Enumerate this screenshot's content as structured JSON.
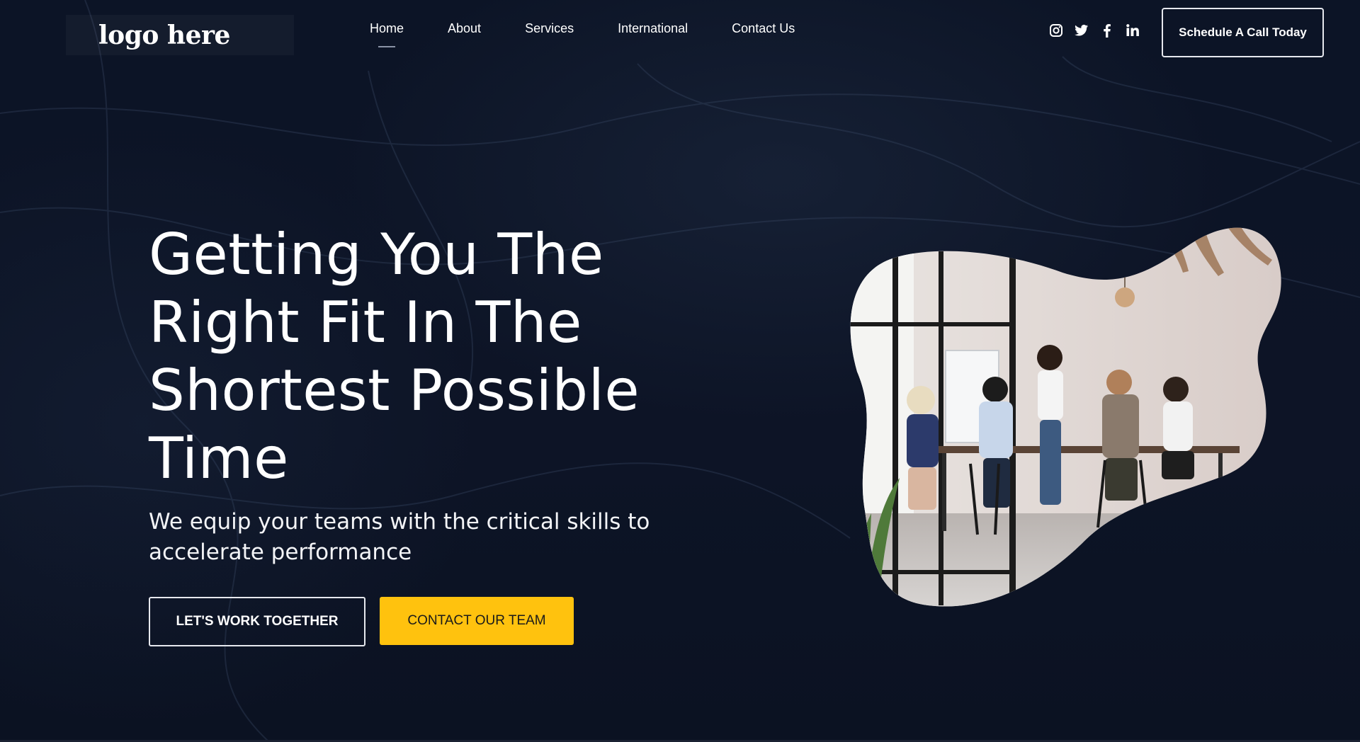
{
  "header": {
    "logo_text": "logo here",
    "nav": [
      {
        "label": "Home",
        "active": true
      },
      {
        "label": "About",
        "active": false
      },
      {
        "label": "Services",
        "active": false
      },
      {
        "label": "International",
        "active": false
      },
      {
        "label": "Contact Us",
        "active": false
      }
    ],
    "socials": [
      "instagram-icon",
      "twitter-icon",
      "facebook-icon",
      "linkedin-icon"
    ],
    "cta_label": "Schedule A Call Today"
  },
  "hero": {
    "title_lines": [
      "Getting You The",
      "Right Fit In The",
      "Shortest Possible",
      "Time"
    ],
    "subtitle_lines": [
      "We equip your teams with the critical skills to",
      "accelerate performance"
    ],
    "primary_button": "LET'S WORK TOGETHER",
    "secondary_button": "CONTACT OUR TEAM"
  },
  "colors": {
    "background": "#0d1426",
    "accent_yellow": "#ffc20e",
    "text": "#ffffff"
  }
}
